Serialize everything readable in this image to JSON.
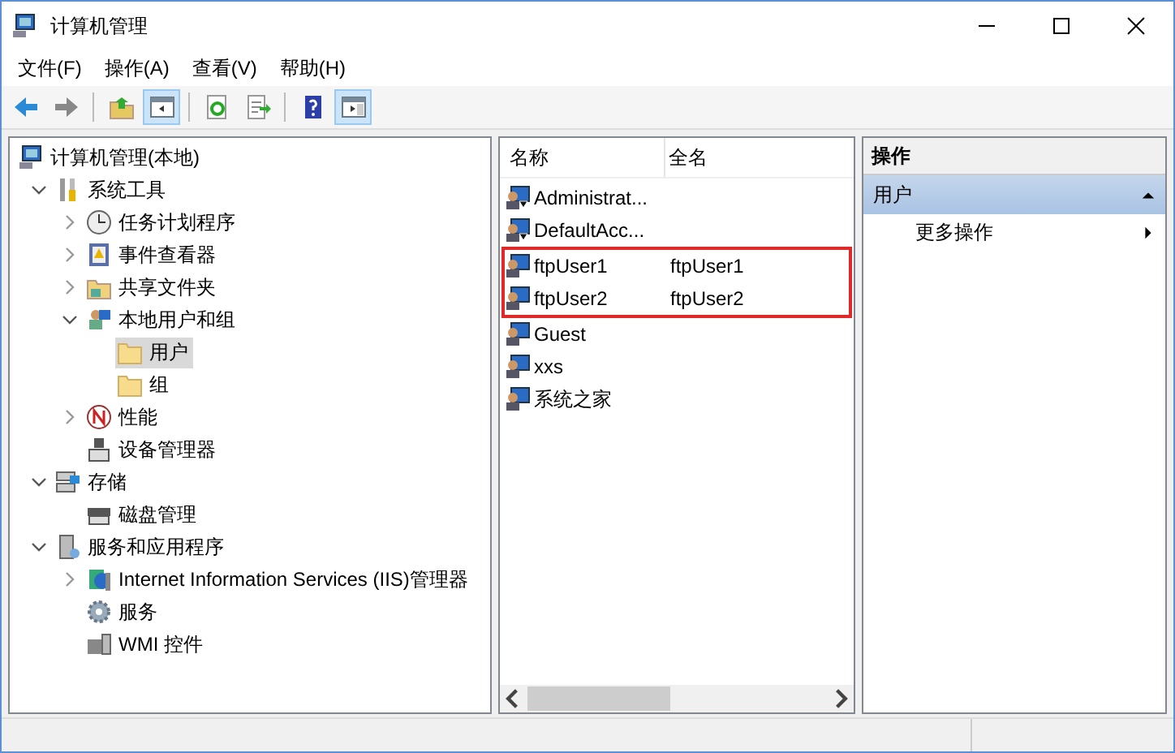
{
  "window": {
    "title": "计算机管理"
  },
  "menu": [
    "文件(F)",
    "操作(A)",
    "查看(V)",
    "帮助(H)"
  ],
  "toolbar": [
    {
      "kind": "back",
      "pressed": false
    },
    {
      "kind": "forward",
      "pressed": false
    },
    {
      "kind": "sep"
    },
    {
      "kind": "up",
      "pressed": false
    },
    {
      "kind": "tree",
      "pressed": true
    },
    {
      "kind": "sep"
    },
    {
      "kind": "refresh",
      "pressed": false
    },
    {
      "kind": "export",
      "pressed": false
    },
    {
      "kind": "sep"
    },
    {
      "kind": "help",
      "pressed": false
    },
    {
      "kind": "actionpane",
      "pressed": true
    }
  ],
  "tree": [
    {
      "label": "计算机管理(本地)",
      "kind": "computer",
      "selected": false,
      "children": [
        {
          "label": "系统工具",
          "kind": "tools",
          "expanded": true,
          "selected": false,
          "children": [
            {
              "label": "任务计划程序",
              "kind": "clock",
              "expanded": false,
              "selected": false
            },
            {
              "label": "事件查看器",
              "kind": "log",
              "expanded": false,
              "selected": false
            },
            {
              "label": "共享文件夹",
              "kind": "share",
              "expanded": false,
              "selected": false
            },
            {
              "label": "本地用户和组",
              "kind": "users",
              "expanded": true,
              "selected": false,
              "children": [
                {
                  "label": "用户",
                  "kind": "folder",
                  "selected": true
                },
                {
                  "label": "组",
                  "kind": "folder",
                  "selected": false
                }
              ]
            },
            {
              "label": "性能",
              "kind": "gauge",
              "expanded": false,
              "selected": false
            },
            {
              "label": "设备管理器",
              "kind": "device",
              "selected": false
            }
          ]
        },
        {
          "label": "存储",
          "kind": "storage",
          "expanded": true,
          "selected": false,
          "children": [
            {
              "label": "磁盘管理",
              "kind": "disk",
              "selected": false
            }
          ]
        },
        {
          "label": "服务和应用程序",
          "kind": "services",
          "expanded": true,
          "selected": false,
          "children": [
            {
              "label": "Internet Information Services (IIS)管理器",
              "kind": "iis",
              "expanded": false,
              "selected": false
            },
            {
              "label": "服务",
              "kind": "gear",
              "selected": false
            },
            {
              "label": "WMI 控件",
              "kind": "wmi",
              "selected": false
            }
          ]
        }
      ]
    }
  ],
  "list": {
    "columns": [
      "名称",
      "全名"
    ],
    "rows": [
      {
        "name": "Administrat...",
        "full_name": "",
        "disabled": true,
        "highlighted": false
      },
      {
        "name": "DefaultAcc...",
        "full_name": "",
        "disabled": true,
        "highlighted": false
      },
      {
        "name": "ftpUser1",
        "full_name": "ftpUser1",
        "disabled": false,
        "highlighted": true
      },
      {
        "name": "ftpUser2",
        "full_name": "ftpUser2",
        "disabled": false,
        "highlighted": true
      },
      {
        "name": "Guest",
        "full_name": "",
        "disabled": false,
        "highlighted": false
      },
      {
        "name": "xxs",
        "full_name": "",
        "disabled": false,
        "highlighted": false
      },
      {
        "name": "系统之家",
        "full_name": "",
        "disabled": false,
        "highlighted": false
      }
    ]
  },
  "actions": {
    "title": "操作",
    "sections": [
      {
        "label": "用户",
        "expanded": true,
        "items": [
          {
            "label": "更多操作",
            "submenu": true
          }
        ]
      }
    ]
  }
}
